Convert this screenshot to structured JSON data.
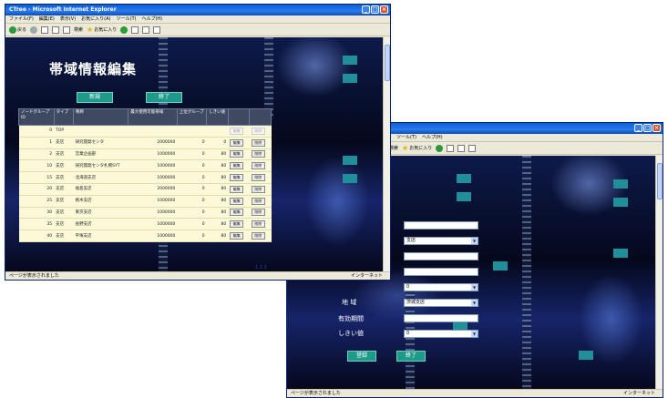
{
  "window1": {
    "title": "CTree - Microsoft Internet Explorer",
    "menu": [
      "ファイル(F)",
      "編集(E)",
      "表示(V)",
      "お気に入り(A)",
      "ツール(T)",
      "ヘルプ(H)"
    ],
    "toolbar": {
      "back": "戻る",
      "search": "検索",
      "favorites": "お気に入り"
    },
    "page_title": "帯域情報編集",
    "new_button": "新規",
    "end_button": "終了",
    "table": {
      "headers": [
        "ノードグループID",
        "タイプ",
        "略称",
        "最大使用可能帯域",
        "上位グループ",
        "しきい値",
        "",
        ""
      ],
      "edit_label": "編集",
      "delete_label": "削除",
      "rows": [
        {
          "id": "0",
          "type": "TOP",
          "name": "",
          "bw": "",
          "parent": "",
          "thr": "",
          "disabled": true
        },
        {
          "id": "1",
          "type": "支店",
          "name": "研究開発センタ",
          "bw": "2000000",
          "parent": "0",
          "thr": "0",
          "disabled": false
        },
        {
          "id": "2",
          "type": "支店",
          "name": "営業企画部",
          "bw": "1000000",
          "parent": "0",
          "thr": "80",
          "disabled": false
        },
        {
          "id": "10",
          "type": "支店",
          "name": "研究開発センタ札幌SYT",
          "bw": "1000000",
          "parent": "0",
          "thr": "80",
          "disabled": false
        },
        {
          "id": "15",
          "type": "支店",
          "name": "北海道支店",
          "bw": "1000000",
          "parent": "0",
          "thr": "80",
          "disabled": false
        },
        {
          "id": "20",
          "type": "支店",
          "name": "福島支店",
          "bw": "2000000",
          "parent": "0",
          "thr": "80",
          "disabled": false
        },
        {
          "id": "25",
          "type": "支店",
          "name": "栃木支店",
          "bw": "1000000",
          "parent": "0",
          "thr": "80",
          "disabled": false
        },
        {
          "id": "30",
          "type": "支店",
          "name": "東京支店",
          "bw": "1000000",
          "parent": "0",
          "thr": "80",
          "disabled": false
        },
        {
          "id": "35",
          "type": "支店",
          "name": "長野支店",
          "bw": "1000000",
          "parent": "0",
          "thr": "80",
          "disabled": false
        },
        {
          "id": "40",
          "type": "支店",
          "name": "平塚支店",
          "bw": "1000000",
          "parent": "0",
          "thr": "80",
          "disabled": false
        }
      ]
    },
    "pager": "1 2 3",
    "status": "ページが表示されました",
    "zone": "インターネット"
  },
  "window2": {
    "menu": [
      "ツール(T)",
      "ヘルプ(H)"
    ],
    "toolbar": {
      "search": "検索",
      "favorites": "お気に入り"
    },
    "fields": [
      {
        "label": "",
        "value": "",
        "select": false
      },
      {
        "label": "",
        "value": "支店",
        "select": true
      },
      {
        "label": "",
        "value": "",
        "select": false
      },
      {
        "label": "",
        "value": "",
        "select": false
      },
      {
        "label": "",
        "value": "0",
        "select": true
      },
      {
        "label": "地 域",
        "value": "茨城支店",
        "select": true
      },
      {
        "label": "有効期間",
        "value": "",
        "select": false
      },
      {
        "label": "しきい値",
        "value": "0",
        "select": true
      }
    ],
    "register_button": "登録",
    "end_button": "終了",
    "status": "ページが表示されました",
    "zone": "インターネット"
  }
}
